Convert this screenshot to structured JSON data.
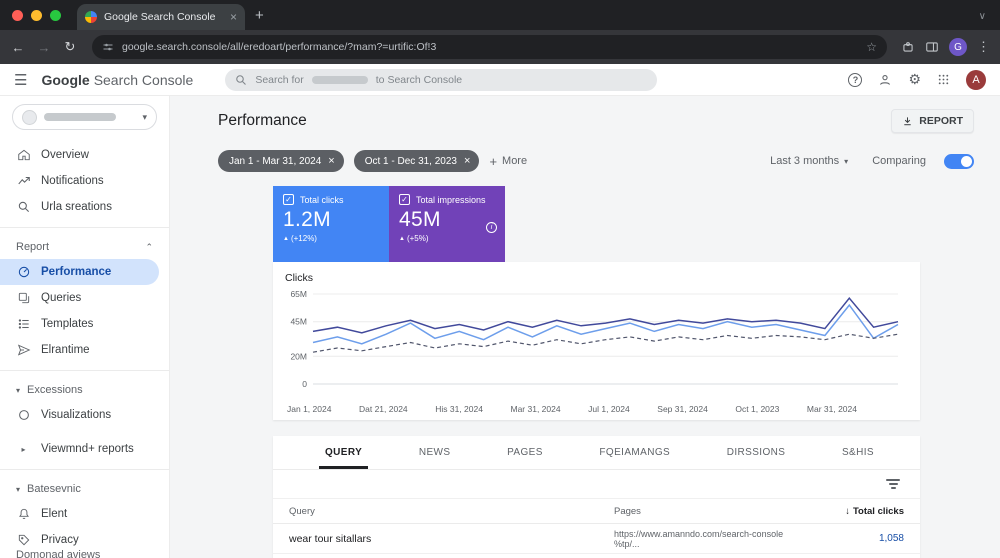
{
  "colors": {
    "card_blue": "#4285f4",
    "card_purple": "#7142b8",
    "toggle_on": "#4285f4",
    "selected_nav_bg": "#d2e3fc",
    "chrome_dark": "#202124"
  },
  "icons": {
    "close": "×",
    "plus": "+",
    "caret_down": "▾",
    "caret_right": "▸",
    "caret_up": "⌃",
    "chevron_down": "∨",
    "back": "←",
    "forward": "→",
    "reload": "↻",
    "star": "☆",
    "hamburger": "☰",
    "help": "?",
    "gear": "⚙",
    "kebab": "⋮",
    "check": "✓",
    "up_triangle": "▲",
    "sort_down": "↓",
    "info": "i"
  },
  "browser": {
    "tab_title": "Google Search Console",
    "url": "google.search.console/all/eredoart/performance/?mam?=urtific:Of!3",
    "profile_letter": "G"
  },
  "app_header": {
    "logo_primary": "Google",
    "logo_secondary": "Search Console",
    "search_prefix": "Search for",
    "search_suffix": "to Search Console",
    "avatar_letter": "A"
  },
  "sidebar": {
    "sections": {
      "report": "Report",
      "excessions": "Excessions",
      "batesevnic": "Batesevnic"
    },
    "items": [
      {
        "label": "Overview"
      },
      {
        "label": "Notifications"
      },
      {
        "label": "Urla sreations"
      },
      {
        "label": "Performance"
      },
      {
        "label": "Queries"
      },
      {
        "label": "Templates"
      },
      {
        "label": "Elrantime"
      },
      {
        "label": "Visualizations"
      },
      {
        "label": "Viewmnd+ reports"
      },
      {
        "label": "Elent"
      },
      {
        "label": "Privacy"
      }
    ],
    "footer": "Domonad aviews"
  },
  "main": {
    "title": "Performance",
    "report_button": "REPORT",
    "filters": {
      "chips": [
        {
          "label": "Jan 1 - Mar 31, 2024"
        },
        {
          "label": "Oct 1 - Dec 31, 2023"
        }
      ],
      "more": "More",
      "range": "Last 3 months",
      "comparing": "Comparing",
      "comparing_on": true
    },
    "cards": [
      {
        "title": "Total clicks",
        "value": "1.2M",
        "delta": "(+12%)"
      },
      {
        "title": "Total impressions",
        "value": "45M",
        "delta": "(+5%)"
      }
    ]
  },
  "chart_data": {
    "type": "line",
    "title": "Clicks",
    "ylabel": "Clicks",
    "ymax": 65,
    "grid": true,
    "legend": "none",
    "yticks": [
      {
        "v": 65,
        "label": "65M"
      },
      {
        "v": 45,
        "label": "45M"
      },
      {
        "v": 20,
        "label": "20M"
      },
      {
        "v": 0,
        "label": "0"
      }
    ],
    "x_tick_labels": [
      "Jan 1, 2024",
      "Dat 21, 2024",
      "His 31, 2024",
      "Mar 31, 2024",
      "Jul 1, 2024",
      "Sep 31, 2024",
      "Oct 1, 2023",
      "Mar 31, 2024"
    ],
    "series": [
      {
        "name": "Clicks (current period)",
        "color": "#41499b",
        "dashed": false,
        "values": [
          38,
          41,
          37,
          42,
          46,
          40,
          43,
          39,
          45,
          41,
          46,
          42,
          44,
          47,
          43,
          46,
          44,
          47,
          45,
          46,
          44,
          40,
          62,
          41,
          45
        ]
      },
      {
        "name": "Clicks (previous period)",
        "color": "#6d9eeb",
        "dashed": false,
        "values": [
          30,
          34,
          29,
          36,
          44,
          33,
          38,
          32,
          41,
          34,
          42,
          36,
          40,
          44,
          38,
          43,
          40,
          45,
          41,
          43,
          39,
          35,
          57,
          33,
          43
        ]
      },
      {
        "name": "Clicks (comparison)",
        "color": "#50556b",
        "dashed": true,
        "values": [
          23,
          26,
          24,
          27,
          30,
          26,
          29,
          27,
          31,
          28,
          32,
          29,
          32,
          34,
          31,
          34,
          32,
          35,
          33,
          35,
          34,
          32,
          36,
          33,
          36
        ]
      }
    ]
  },
  "table": {
    "tabs": [
      "QUERY",
      "NEWS",
      "PAGES",
      "FQEIAMANGS",
      "DIRSSIONS",
      "S&HIS"
    ],
    "columns": {
      "query": "Query",
      "pages": "Pages",
      "clicks": "Total clicks"
    },
    "rows": [
      {
        "query": "wear tour sitallars",
        "pages": "https://www.amanndo.com/search-console %tp/...",
        "clicks": "1,058"
      }
    ]
  }
}
